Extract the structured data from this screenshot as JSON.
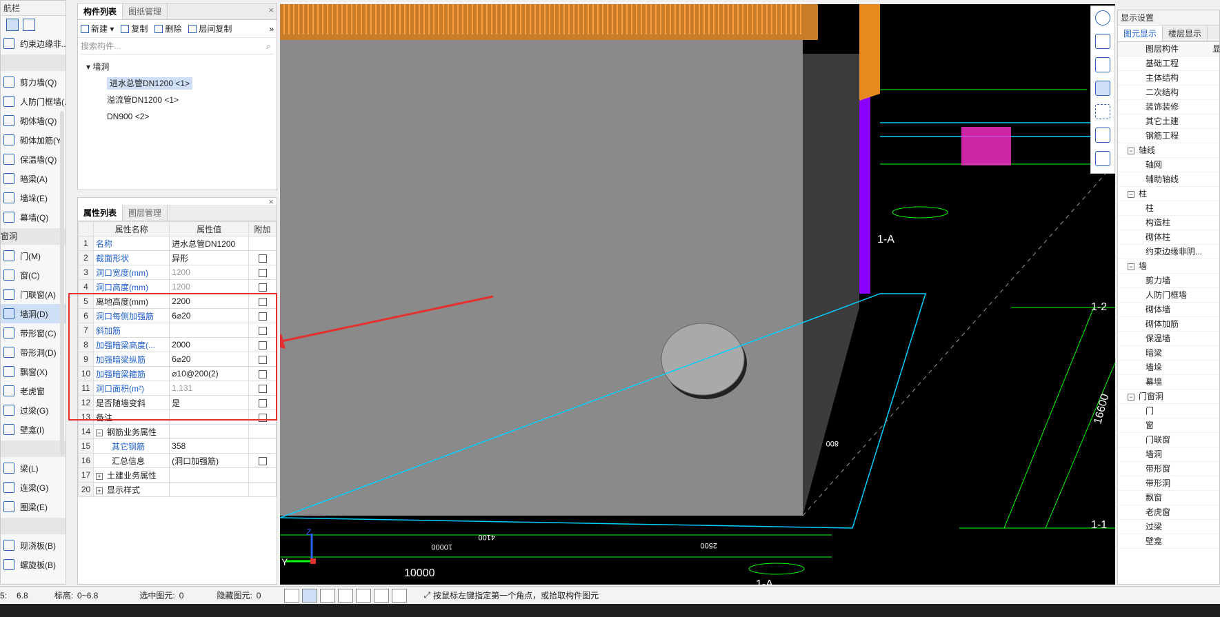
{
  "nav": {
    "title": "航栏",
    "items": [
      {
        "label": "约束边缘非..."
      },
      {
        "group": ""
      },
      {
        "label": "剪力墙(Q)"
      },
      {
        "label": "人防门框墙(..."
      },
      {
        "label": "砌体墙(Q)"
      },
      {
        "label": "砌体加筋(Y)"
      },
      {
        "label": "保温墙(Q)"
      },
      {
        "label": "暗梁(A)"
      },
      {
        "label": "墙垛(E)"
      },
      {
        "label": "幕墙(Q)"
      },
      {
        "group": "窗洞"
      },
      {
        "label": "门(M)"
      },
      {
        "label": "窗(C)"
      },
      {
        "label": "门联窗(A)"
      },
      {
        "label": "墙洞(D)",
        "selected": true
      },
      {
        "label": "带形窗(C)"
      },
      {
        "label": "带形洞(D)"
      },
      {
        "label": "飘窗(X)"
      },
      {
        "label": "老虎窗"
      },
      {
        "label": "过梁(G)"
      },
      {
        "label": "壁龛(I)"
      },
      {
        "group": ""
      },
      {
        "label": "梁(L)"
      },
      {
        "label": "连梁(G)"
      },
      {
        "label": "圈梁(E)"
      },
      {
        "group": ""
      },
      {
        "label": "现浇板(B)"
      },
      {
        "label": "螺旋板(B)"
      }
    ]
  },
  "comp": {
    "tab1": "构件列表",
    "tab2": "图纸管理",
    "new": "新建",
    "copy": "复制",
    "del": "删除",
    "floorcopy": "层间复制",
    "search": "搜索构件...",
    "root": "墙洞",
    "items": [
      "进水总管DN1200 <1>",
      "溢流管DN1200 <1>",
      "DN900 <2>"
    ]
  },
  "props": {
    "tab1": "属性列表",
    "tab2": "图层管理",
    "h1": "属性名称",
    "h2": "属性值",
    "h3": "附加",
    "rows": [
      {
        "n": "1",
        "name": "名称",
        "val": "进水总管DN1200",
        "blue": true,
        "chk": false
      },
      {
        "n": "2",
        "name": "截面形状",
        "val": "异形",
        "blue": true,
        "chk": true
      },
      {
        "n": "3",
        "name": "洞口宽度(mm)",
        "val": "1200",
        "blue": true,
        "gray": true,
        "chk": true
      },
      {
        "n": "4",
        "name": "洞口高度(mm)",
        "val": "1200",
        "blue": true,
        "gray": true,
        "chk": true
      },
      {
        "n": "5",
        "name": "离地高度(mm)",
        "val": "2200",
        "blue": false,
        "chk": true
      },
      {
        "n": "6",
        "name": "洞口每侧加强筋",
        "val": "6⌀20",
        "blue": true,
        "chk": true
      },
      {
        "n": "7",
        "name": "斜加筋",
        "val": "",
        "blue": true,
        "chk": true
      },
      {
        "n": "8",
        "name": "加强暗梁高度(...",
        "val": "2000",
        "blue": true,
        "chk": true
      },
      {
        "n": "9",
        "name": "加强暗梁纵筋",
        "val": "6⌀20",
        "blue": true,
        "chk": true
      },
      {
        "n": "10",
        "name": "加强暗梁箍筋",
        "val": "⌀10@200(2)",
        "blue": true,
        "chk": true
      },
      {
        "n": "11",
        "name": "洞口面积(m²)",
        "val": "1.131",
        "blue": true,
        "gray": true,
        "chk": true
      },
      {
        "n": "12",
        "name": "是否随墙变斜",
        "val": "是",
        "blue": false,
        "chk": true
      },
      {
        "n": "13",
        "name": "备注",
        "val": "",
        "blue": false,
        "chk": true
      },
      {
        "n": "14",
        "name": "钢筋业务属性",
        "val": "",
        "blue": false,
        "chk": false,
        "expand": "−"
      },
      {
        "n": "15",
        "name": "其它钢筋",
        "val": "358",
        "blue": true,
        "indent": true,
        "chk": false
      },
      {
        "n": "16",
        "name": "汇总信息",
        "val": "(洞口加强筋)",
        "blue": false,
        "indent": true,
        "chk": true
      },
      {
        "n": "17",
        "name": "土建业务属性",
        "val": "",
        "blue": false,
        "chk": false,
        "expand": "+"
      },
      {
        "n": "20",
        "name": "显示样式",
        "val": "",
        "blue": false,
        "chk": false,
        "expand": "+"
      }
    ]
  },
  "canvas": {
    "dim1": "10000",
    "dim2": "1-A",
    "dim3": "1-A",
    "dim4": "1-2",
    "dim5": "1-1",
    "dim6": "16600",
    "dim7": "800",
    "dim8": "2500",
    "dim9": "4100",
    "dim10": "10000",
    "axisY": "Y",
    "axisZ": "Z"
  },
  "right": {
    "title": "显示设置",
    "tab1": "图元显示",
    "tab2": "楼层显示",
    "h1": "图层构件",
    "h2": "显",
    "rows": [
      {
        "t": "基础工程",
        "l": 2
      },
      {
        "t": "主体结构",
        "l": 2
      },
      {
        "t": "二次结构",
        "l": 2
      },
      {
        "t": "装饰装修",
        "l": 2
      },
      {
        "t": "其它土建",
        "l": 2
      },
      {
        "t": "钢筋工程",
        "l": 2
      },
      {
        "t": "轴线",
        "l": 1
      },
      {
        "t": "轴网",
        "l": 2
      },
      {
        "t": "辅助轴线",
        "l": 2
      },
      {
        "t": "柱",
        "l": 1
      },
      {
        "t": "柱",
        "l": 2
      },
      {
        "t": "构造柱",
        "l": 2
      },
      {
        "t": "砌体柱",
        "l": 2
      },
      {
        "t": "约束边缘非阴...",
        "l": 2
      },
      {
        "t": "墙",
        "l": 1
      },
      {
        "t": "剪力墙",
        "l": 2
      },
      {
        "t": "人防门框墙",
        "l": 2
      },
      {
        "t": "砌体墙",
        "l": 2
      },
      {
        "t": "砌体加筋",
        "l": 2
      },
      {
        "t": "保温墙",
        "l": 2
      },
      {
        "t": "暗梁",
        "l": 2
      },
      {
        "t": "墙垛",
        "l": 2
      },
      {
        "t": "幕墙",
        "l": 2
      },
      {
        "t": "门窗洞",
        "l": 1
      },
      {
        "t": "门",
        "l": 2
      },
      {
        "t": "窗",
        "l": 2
      },
      {
        "t": "门联窗",
        "l": 2
      },
      {
        "t": "墙洞",
        "l": 2
      },
      {
        "t": "带形窗",
        "l": 2
      },
      {
        "t": "带形洞",
        "l": 2
      },
      {
        "t": "飘窗",
        "l": 2
      },
      {
        "t": "老虎窗",
        "l": 2
      },
      {
        "t": "过梁",
        "l": 2
      },
      {
        "t": "壁龛",
        "l": 2
      }
    ]
  },
  "status": {
    "a": "5:",
    "av": "6.8",
    "b": "标高:",
    "bv": "0~6.8",
    "c": "选中图元:",
    "cv": "0",
    "d": "隐藏图元:",
    "dv": "0",
    "hint": "按鼠标左键指定第一个角点，或拾取构件图元"
  }
}
